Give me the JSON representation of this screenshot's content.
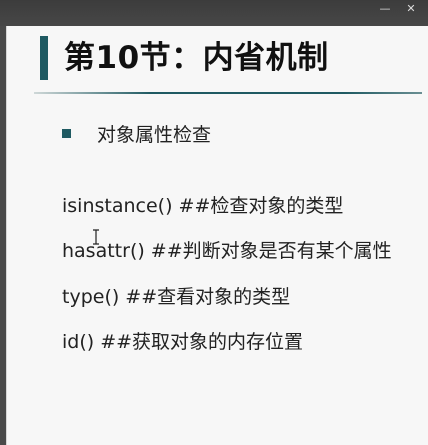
{
  "window": {
    "minimize_icon": "minimize-icon",
    "close_icon": "close-icon"
  },
  "slide": {
    "title": "第10节：内省机制",
    "accent_color": "#1f5a62",
    "bullet": "对象属性检查",
    "lines": [
      "isinstance() ##检查对象的类型",
      "hasattr() ##判断对象是否有某个属性",
      "type() ##查看对象的类型",
      "id() ##获取对象的内存位置"
    ]
  }
}
